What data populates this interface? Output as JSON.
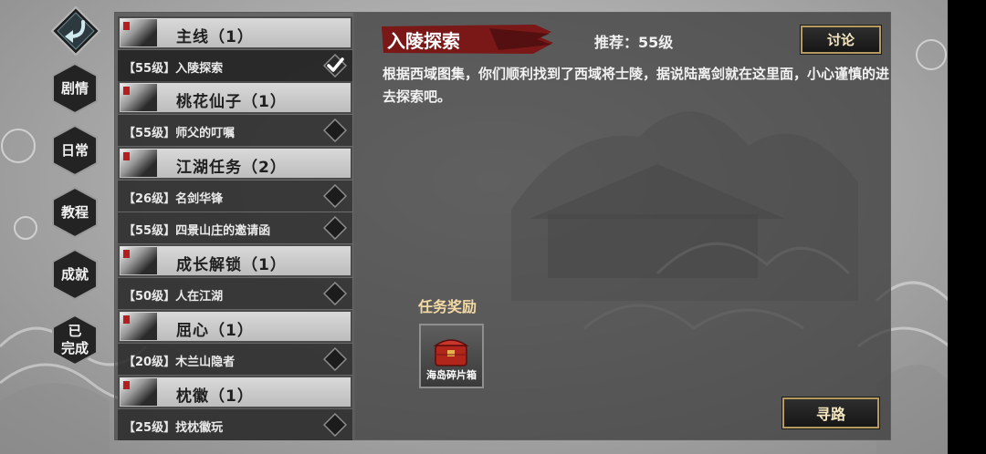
{
  "nav": {
    "items": [
      {
        "label": "剧情"
      },
      {
        "label": "日常"
      },
      {
        "label": "教程"
      },
      {
        "label": "成就"
      },
      {
        "label": "已\n完成"
      }
    ]
  },
  "quest_list": {
    "categories": [
      {
        "label": "主线（1）",
        "quests": [
          {
            "label": "【55级】入陵探索",
            "state": "completed-check"
          }
        ]
      },
      {
        "label": "桃花仙子（1）",
        "quests": [
          {
            "label": "【55级】师父的叮嘱",
            "state": "diamond"
          }
        ]
      },
      {
        "label": "江湖任务（2）",
        "quests": [
          {
            "label": "【26级】名剑华锋",
            "state": "diamond"
          },
          {
            "label": "【55级】四景山庄的邀请函",
            "state": "diamond"
          }
        ]
      },
      {
        "label": "成长解锁（1）",
        "quests": [
          {
            "label": "【50级】人在江湖",
            "state": "diamond"
          }
        ]
      },
      {
        "label": "屈心（1）",
        "quests": [
          {
            "label": "【20级】木兰山隐者",
            "state": "diamond"
          }
        ]
      },
      {
        "label": "枕徽（1）",
        "quests": [
          {
            "label": "【25级】找枕徽玩",
            "state": "diamond"
          }
        ]
      }
    ]
  },
  "detail": {
    "title": "入陵探索",
    "recommend": "推荐：55级",
    "discuss_label": "讨论",
    "description": "根据西域图集，你们顺利找到了西域将士陵，据说陆离剑就在这里面，小心谨慎的进去探索吧。",
    "rewards_title": "任务奖励",
    "reward_item": {
      "label": "海岛碎片箱",
      "icon": "chest-icon"
    },
    "pathfind_label": "寻路"
  },
  "colors": {
    "banner_red": "#7a1717",
    "button_border": "#b59b62",
    "reward_title": "#f3d9a4"
  }
}
